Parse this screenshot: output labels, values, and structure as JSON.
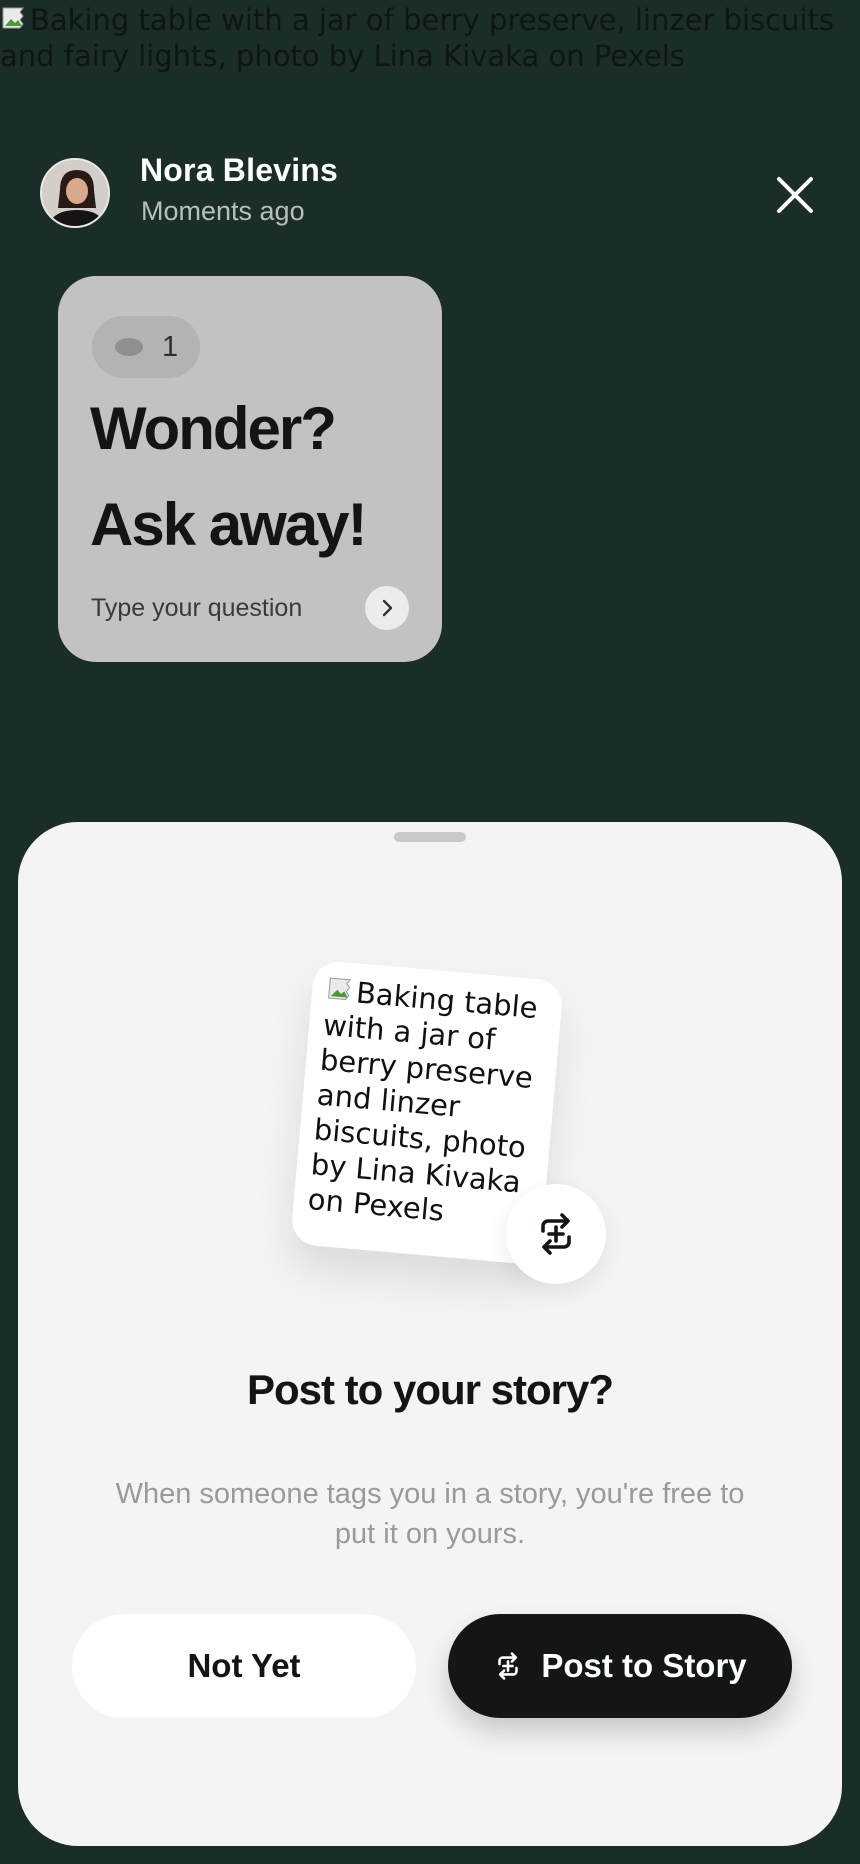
{
  "background": {
    "alt_text": "Baking table with a jar of berry preserve, linzer biscuits and fairy lights, photo by Lina Kivaka on Pexels"
  },
  "header": {
    "user_name": "Nora Blevins",
    "timestamp": "Moments ago",
    "close_icon": "close-icon"
  },
  "question_card": {
    "view_count": "1",
    "title_line1": "Wonder?",
    "title_line2": "Ask away!",
    "placeholder": "Type your question"
  },
  "sheet": {
    "preview_alt": "Baking table with a jar of berry preserve and linzer biscuits, photo by Lina Kivaka on Pexels",
    "title": "Post to your story?",
    "description": "When someone tags you in a story, you're free to put it on yours.",
    "secondary_label": "Not Yet",
    "primary_label": "Post to Story"
  },
  "colors": {
    "background": "#1b2d27",
    "sheet": "#f4f4f4",
    "primary_button": "#121614",
    "card": "#c2c2c2"
  }
}
